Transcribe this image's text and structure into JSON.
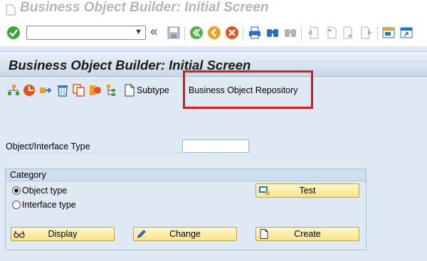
{
  "window": {
    "title": "Business Object Builder: Initial Screen"
  },
  "system_toolbar": {
    "command_field_value": "",
    "double_chevron": "«",
    "icons": [
      "enter-icon",
      "save-icon",
      "back-icon",
      "exit-icon",
      "cancel-icon",
      "print-icon",
      "find-icon",
      "find-next-icon",
      "first-page-icon",
      "previous-page-icon",
      "next-page-icon",
      "last-page-icon",
      "create-session-icon",
      "shortcut-icon"
    ]
  },
  "header": {
    "title": "Business Object Builder: Initial Screen"
  },
  "app_toolbar": {
    "icons": [
      "hierarchy-icon",
      "delete-icon",
      "copy-object-icon",
      "trash-icon",
      "copy-icon",
      "display-object-icon",
      "tree-icon",
      "document-icon"
    ],
    "subtype_label": "Subtype",
    "bor_label": "Business Object Repository"
  },
  "form": {
    "field_label": "Object/Interface Type",
    "field_value": ""
  },
  "category": {
    "title": "Category",
    "options": [
      {
        "label": "Object type",
        "selected": true
      },
      {
        "label": "Interface type",
        "selected": false
      }
    ],
    "buttons": {
      "test": "Test",
      "display": "Display",
      "change": "Change",
      "create": "Create"
    }
  },
  "colors": {
    "highlight": "#e0161d",
    "button": "#f7e58a",
    "background": "#dfe9f3"
  }
}
